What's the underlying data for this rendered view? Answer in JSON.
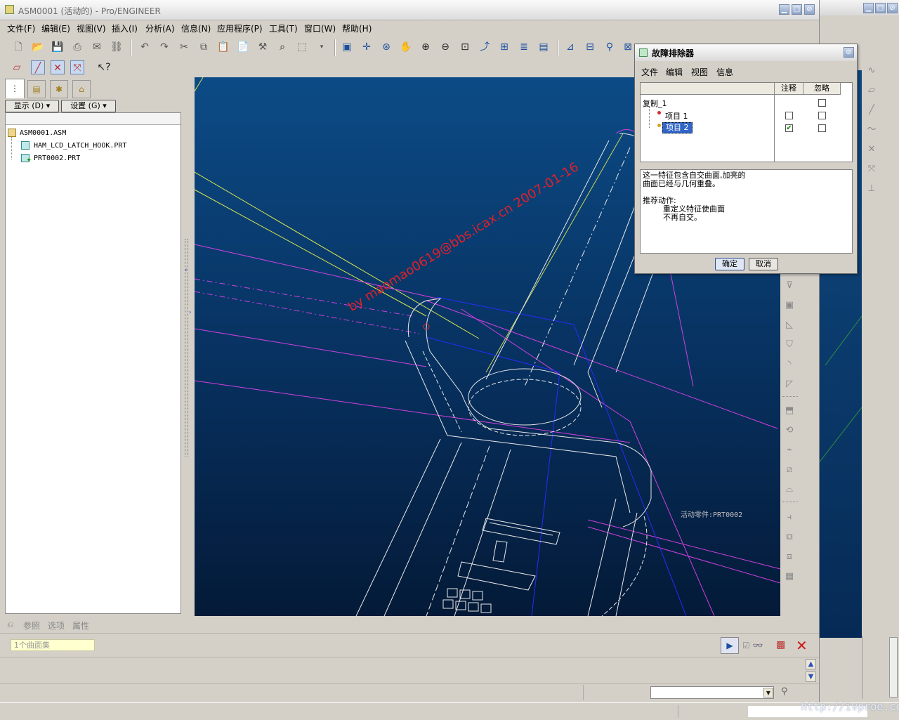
{
  "window": {
    "title": "ASM0001 (活动的) - Pro/ENGINEER"
  },
  "menubar": [
    "文件(F)",
    "编辑(E)",
    "视图(V)",
    "插入(I)",
    "分析(A)",
    "信息(N)",
    "应用程序(P)",
    "工具(T)",
    "窗口(W)",
    "帮助(H)"
  ],
  "navigator": {
    "display_btn": "显示 (D) ▾",
    "settings_btn": "设置 (G) ▾",
    "tree": [
      {
        "label": "ASM0001.ASM"
      },
      {
        "label": "HAM_LCD_LATCH_HOOK.PRT"
      },
      {
        "label": "PRT0002.PRT"
      }
    ]
  },
  "canvas": {
    "watermark": "by maomao0619@bbs.icax.cn 2007-01-16",
    "active_part": "活动零件:PRT0002"
  },
  "dashboard": {
    "tabs": [
      "参照",
      "选项",
      "属性"
    ],
    "collector_text": "1个曲面集"
  },
  "troubleshooter": {
    "title": "故障排除器",
    "menu": [
      "文件",
      "编辑",
      "视图",
      "信息"
    ],
    "col_note": "注释",
    "col_ignore": "忽略",
    "rows": [
      {
        "label": "复制_1",
        "note": null,
        "ignore": false
      },
      {
        "label": "项目 1",
        "note": false,
        "ignore": false
      },
      {
        "label": "项目 2",
        "note": true,
        "ignore": false,
        "selected": true
      }
    ],
    "message_lines": [
      "这一特征包含自交曲面,加亮的",
      "曲面已经与几何重叠。",
      "",
      "推荐动作:",
      "重定义特征使曲面",
      "不再自交。"
    ],
    "ok": "确定",
    "cancel": "取消"
  },
  "status": {
    "url": "http://ivproe.com"
  }
}
